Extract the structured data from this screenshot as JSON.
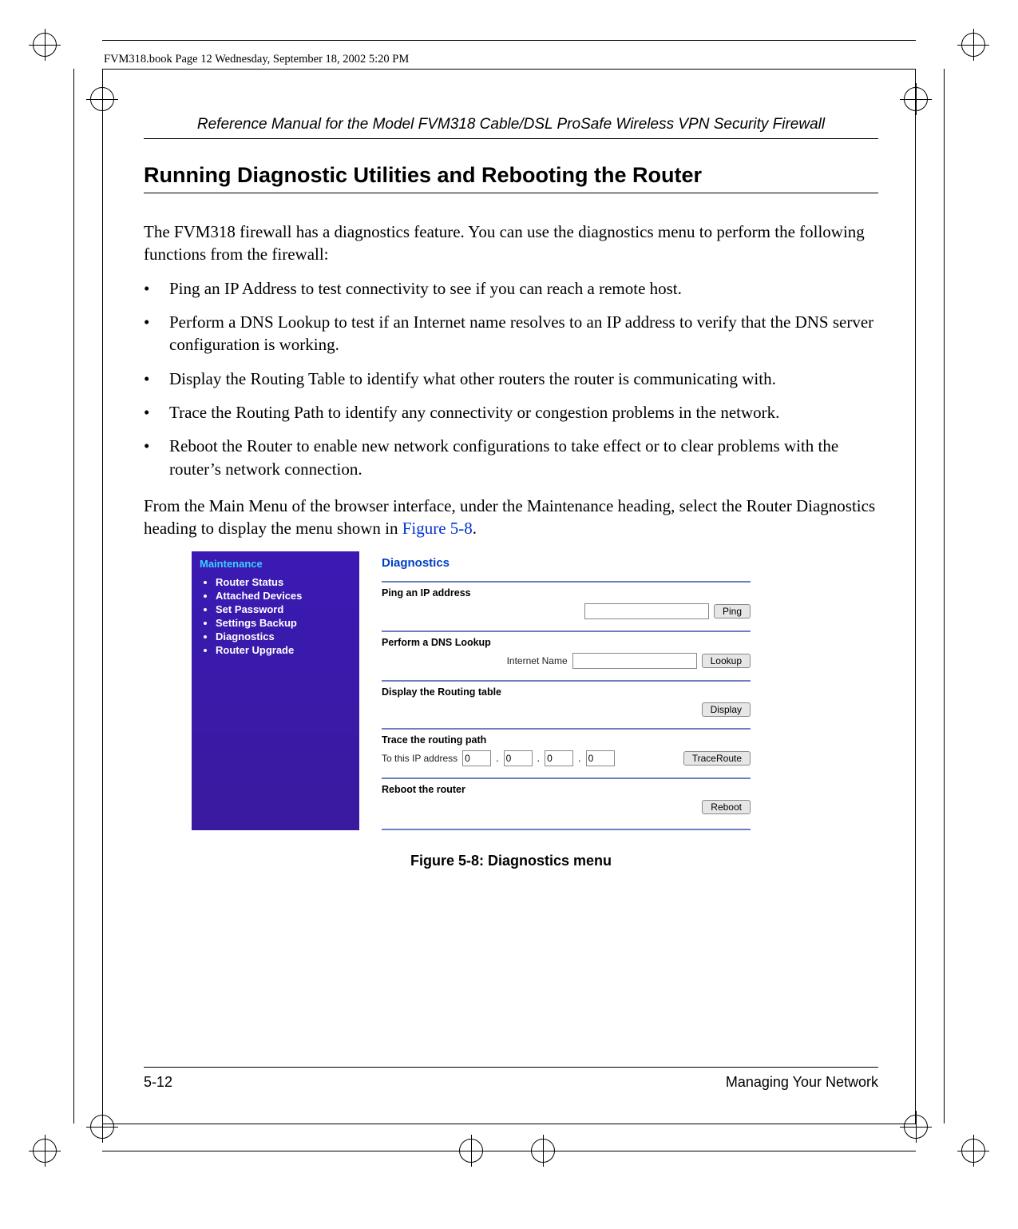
{
  "meta_line": "FVM318.book  Page 12  Wednesday, September 18, 2002  5:20 PM",
  "running_head": "Reference Manual for the Model FVM318 Cable/DSL ProSafe Wireless VPN Security Firewall",
  "section_title": "Running Diagnostic Utilities and Rebooting the Router",
  "intro": "The FVM318 firewall has a diagnostics feature. You can use the diagnostics menu to perform the following functions from the firewall:",
  "bullets": [
    "Ping an IP Address to test connectivity to see if you can reach a remote host.",
    "Perform a DNS Lookup to test if an Internet name resolves to an IP address to verify that the DNS server configuration is working.",
    "Display the Routing Table to identify what other routers the router is communicating with.",
    "Trace the Routing Path to identify any connectivity or congestion problems in the network.",
    "Reboot the Router to enable new network configurations to take effect or to clear problems with the router’s network connection."
  ],
  "lead_out_pre": "From the Main Menu of the browser interface, under the Maintenance heading, select the Router Diagnostics heading to display the menu shown in ",
  "figure_ref": "Figure 5-8",
  "lead_out_post": ".",
  "sidebar": {
    "heading": "Maintenance",
    "items": [
      "Router Status",
      "Attached Devices",
      "Set Password",
      "Settings Backup",
      "Diagnostics",
      "Router Upgrade"
    ]
  },
  "panel": {
    "title": "Diagnostics",
    "ping": {
      "title": "Ping an IP address",
      "button": "Ping"
    },
    "dns": {
      "title": "Perform a DNS Lookup",
      "label": "Internet Name",
      "button": "Lookup"
    },
    "route": {
      "title": "Display the Routing table",
      "button": "Display"
    },
    "trace": {
      "title": "Trace the routing path",
      "label": "To this IP address",
      "button": "TraceRoute",
      "ip": [
        "0",
        "0",
        "0",
        "0"
      ]
    },
    "reboot": {
      "title": "Reboot the router",
      "button": "Reboot"
    }
  },
  "figure_caption": "Figure 5-8: Diagnostics menu",
  "footer": {
    "page": "5-12",
    "chapter": "Managing Your Network"
  }
}
